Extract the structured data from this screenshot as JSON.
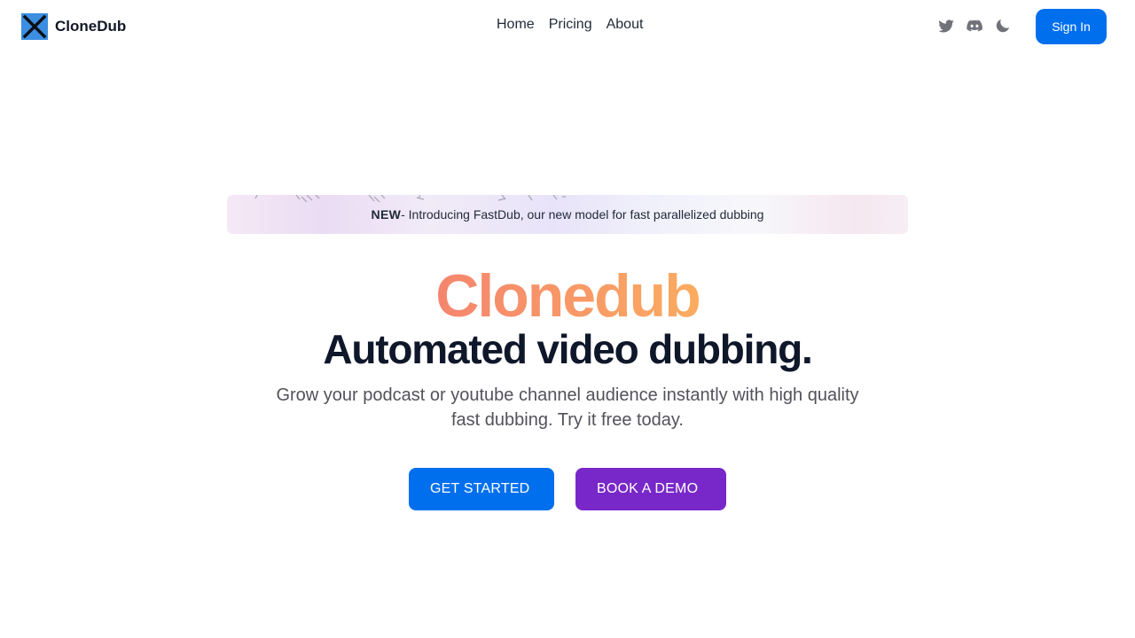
{
  "brand": {
    "name": "CloneDub",
    "logo_icon": "x-logo-icon"
  },
  "nav": {
    "links": [
      "Home",
      "Pricing",
      "About"
    ],
    "icons": [
      "twitter-icon",
      "discord-icon",
      "moon-icon"
    ],
    "sign_in_label": "Sign In"
  },
  "banner": {
    "label": "NEW",
    "text": " - Introducing FastDub, our new model for fast parallelized dubbing"
  },
  "hero": {
    "title": "Clonedub",
    "subtitle": "Automated video dubbing.",
    "description": "Grow your podcast or youtube channel audience instantly with high quality fast dubbing. Try it free today.",
    "primary_cta": "GET STARTED",
    "secondary_cta": "BOOK A DEMO"
  },
  "colors": {
    "primary": "#006fee",
    "secondary": "#7828c8",
    "title_gradient_start": "#f5856e",
    "title_gradient_end": "#fbac60"
  }
}
